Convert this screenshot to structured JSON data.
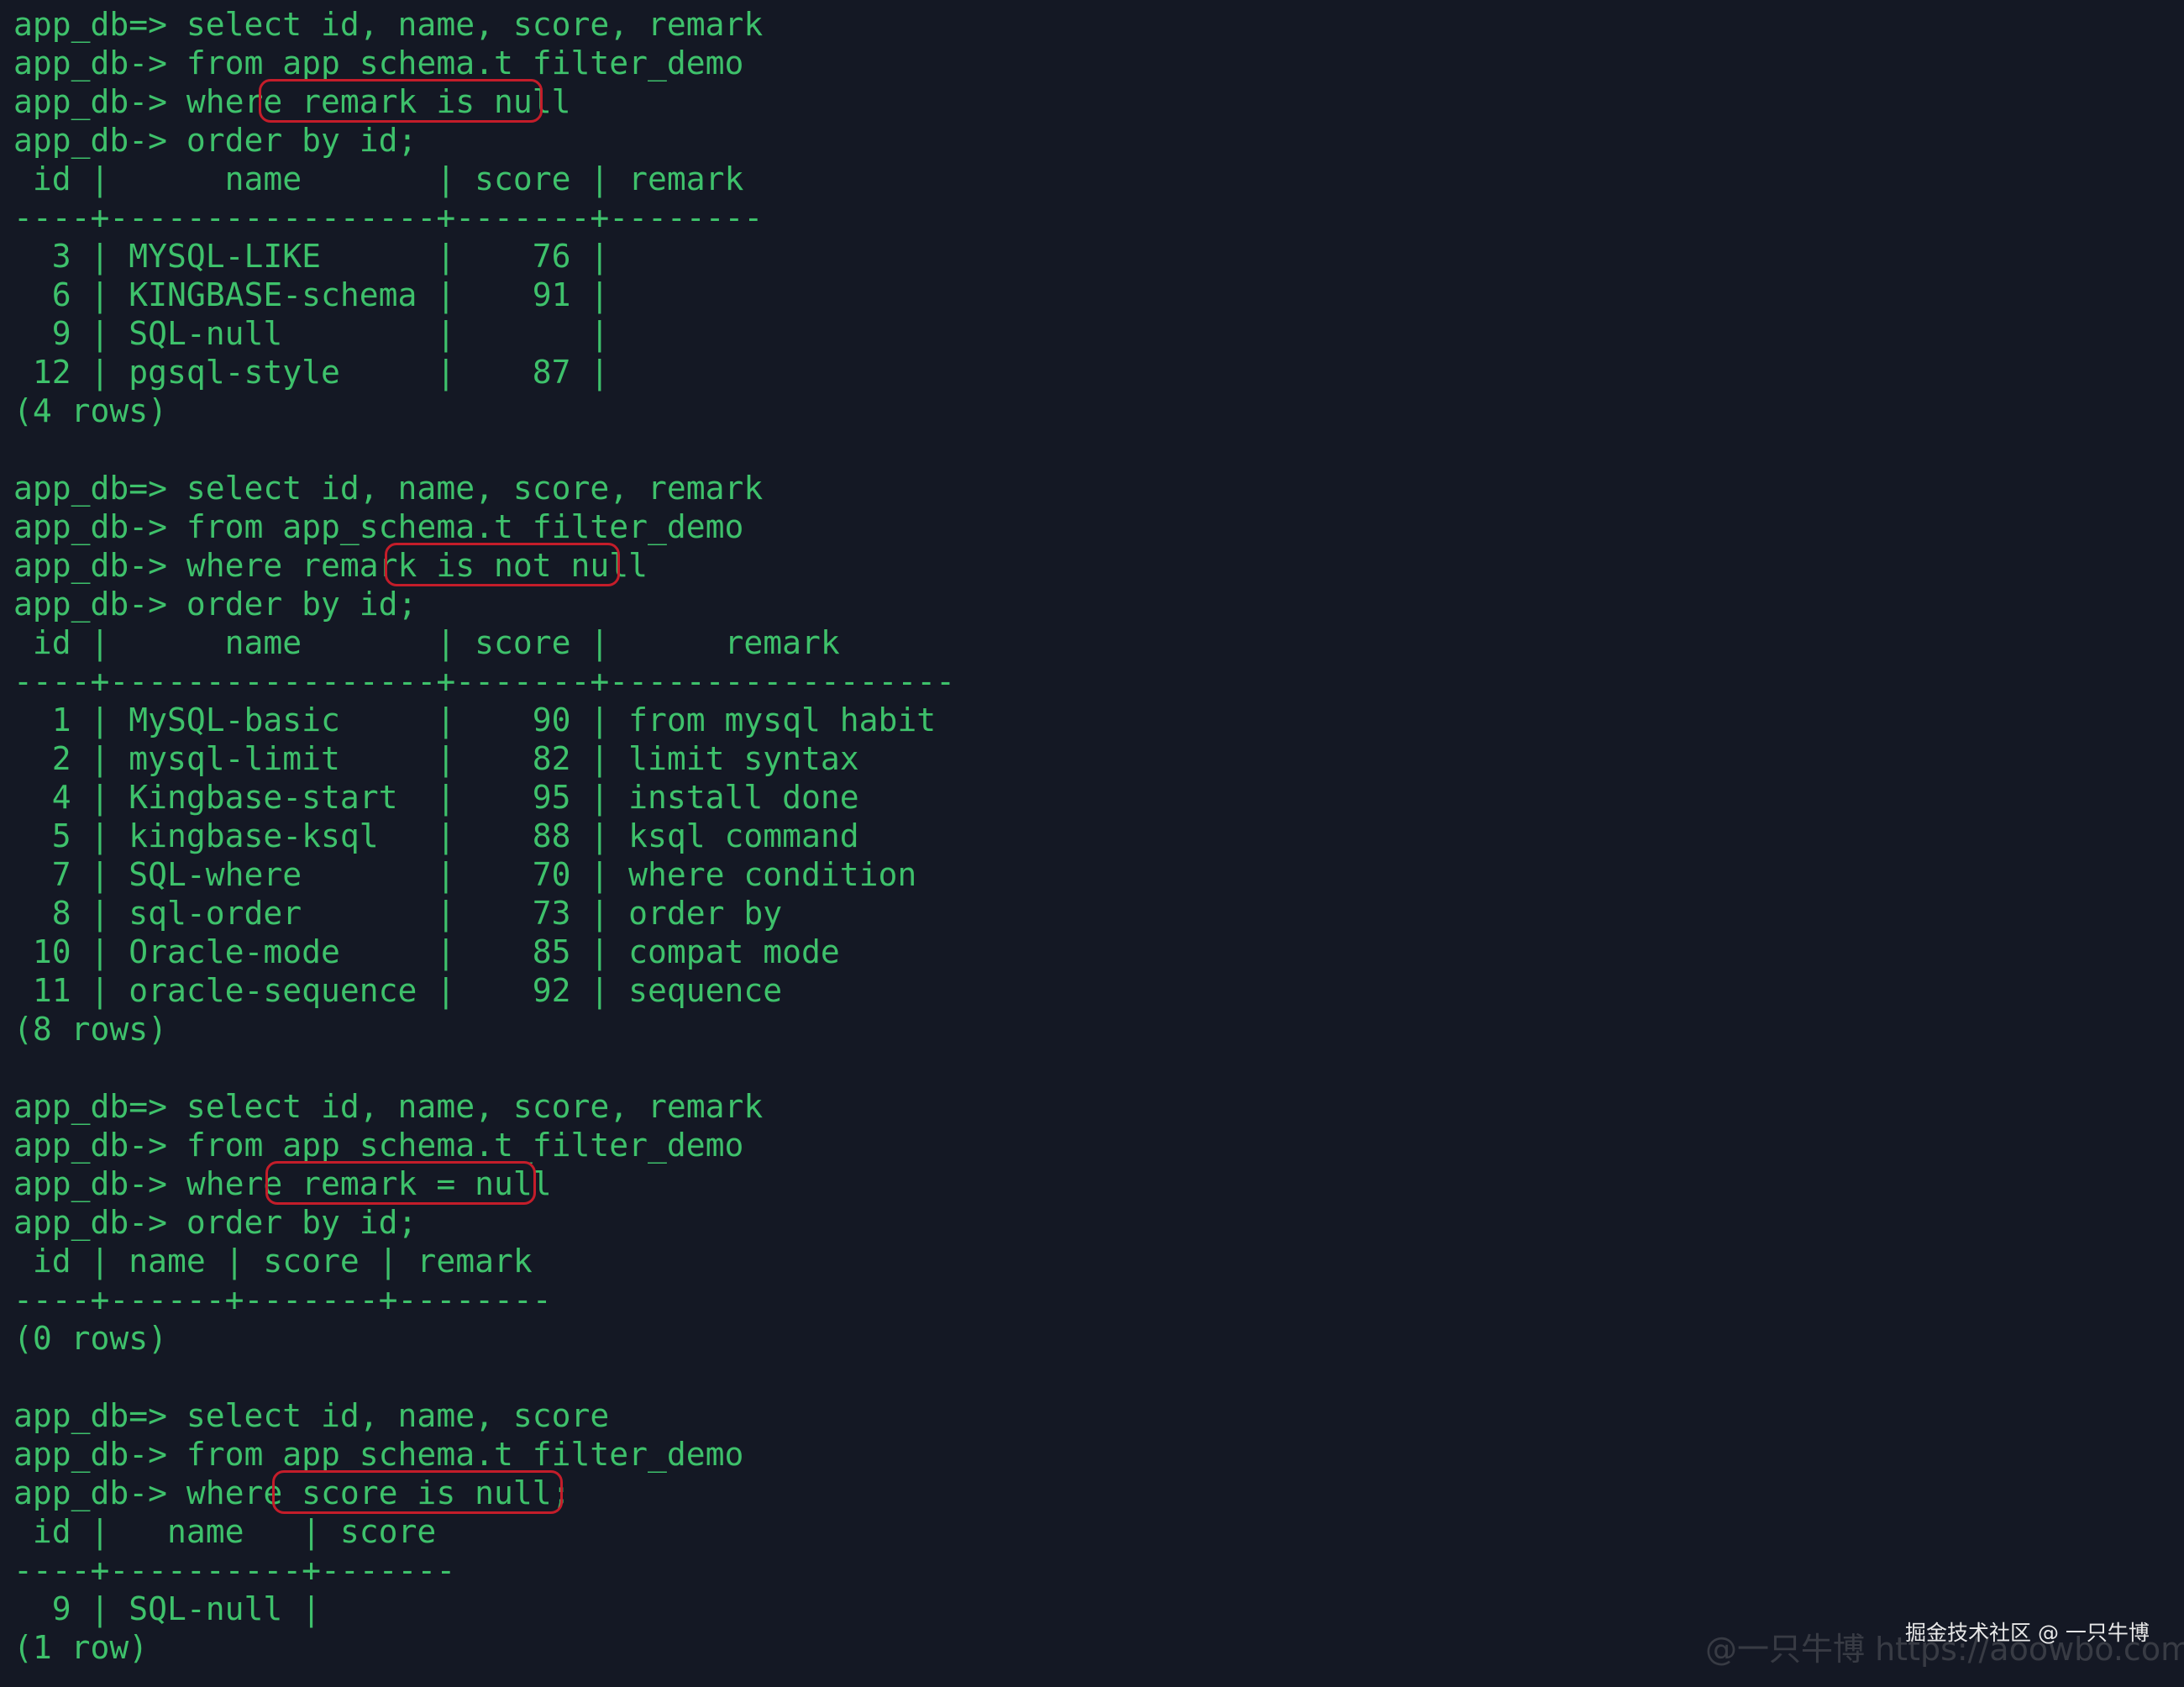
{
  "terminal": {
    "lines": [
      "app_db=> select id, name, score, remark",
      "app_db-> from app_schema.t_filter_demo",
      "app_db-> where remark is null",
      "app_db-> order by id;",
      " id |      name       | score | remark",
      "----+-----------------+-------+--------",
      "  3 | MYSQL-LIKE      |    76 |",
      "  6 | KINGBASE-schema |    91 |",
      "  9 | SQL-null        |       |",
      " 12 | pgsql-style     |    87 |",
      "(4 rows)",
      "",
      "app_db=> select id, name, score, remark",
      "app_db-> from app_schema.t_filter_demo",
      "app_db-> where remark is not null",
      "app_db-> order by id;",
      " id |      name       | score |      remark",
      "----+-----------------+-------+------------------",
      "  1 | MySQL-basic     |    90 | from mysql habit",
      "  2 | mysql-limit     |    82 | limit syntax",
      "  4 | Kingbase-start  |    95 | install done",
      "  5 | kingbase-ksql   |    88 | ksql command",
      "  7 | SQL-where       |    70 | where condition",
      "  8 | sql-order       |    73 | order by",
      " 10 | Oracle-mode     |    85 | compat mode",
      " 11 | oracle-sequence |    92 | sequence",
      "(8 rows)",
      "",
      "app_db=> select id, name, score, remark",
      "app_db-> from app_schema.t_filter_demo",
      "app_db-> where remark = null",
      "app_db-> order by id;",
      " id | name | score | remark",
      "----+------+-------+--------",
      "(0 rows)",
      "",
      "app_db=> select id, name, score",
      "app_db-> from app_schema.t_filter_demo",
      "app_db-> where score is null;",
      " id |   name   | score",
      "----+----------+-------",
      "  9 | SQL-null |",
      "(1 row)"
    ],
    "highlighted_conditions": [
      "remark is null",
      "is not null",
      "remark = null",
      "score is null;"
    ]
  },
  "watermark": {
    "primary": "掘金技术社区 @ 一只牛博",
    "secondary": "@一只牛博 https://aoowbo.com"
  },
  "colors": {
    "background": "#141824",
    "text": "#3ec16b",
    "highlight": "#c41d2a"
  }
}
